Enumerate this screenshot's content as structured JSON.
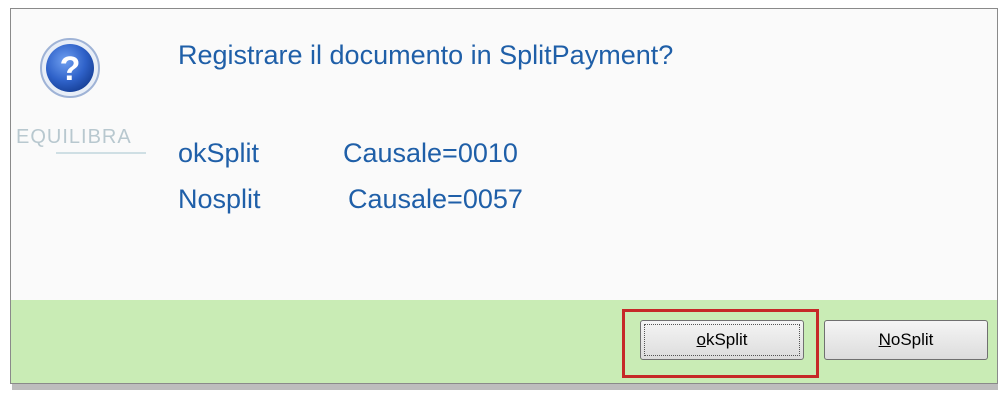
{
  "dialog": {
    "message": "Registrare il documento in SplitPayment?",
    "options": [
      {
        "name": "okSplit",
        "value": "Causale=0010"
      },
      {
        "name": "Nosplit",
        "value": "Causale=0057"
      }
    ],
    "watermark": "EQUILIBRA"
  },
  "buttons": {
    "ok": {
      "mnemonic": "o",
      "rest": "kSplit"
    },
    "no": {
      "mnemonic": "N",
      "rest": "oSplit"
    }
  },
  "colors": {
    "message_text": "#1f5fa8",
    "button_bar": "#c9ecb5",
    "highlight": "#c62828"
  },
  "icons": {
    "dialog_icon": "question-icon"
  }
}
